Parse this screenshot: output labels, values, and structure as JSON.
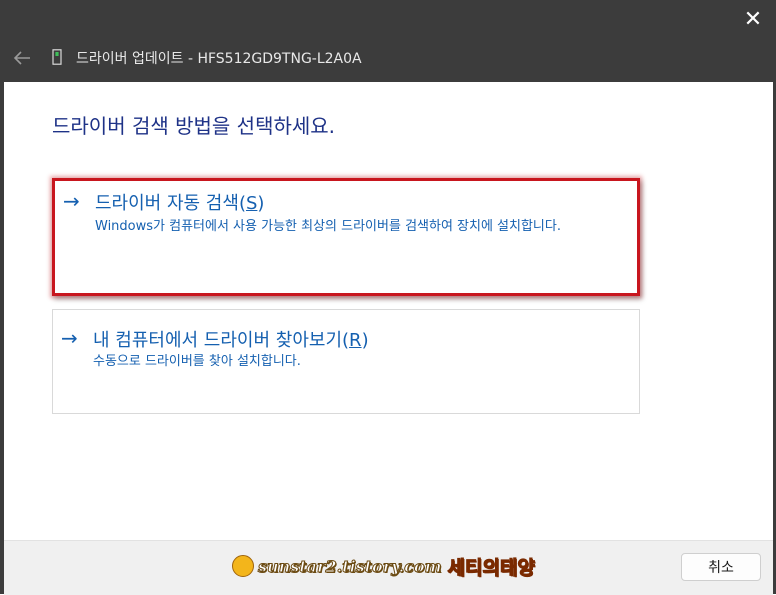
{
  "window": {
    "title": "드라이버 업데이트 - HFS512GD9TNG-L2A0A",
    "close_icon": "close-icon",
    "back_icon": "back-arrow-icon",
    "device_icon": "device-icon"
  },
  "heading": "드라이버 검색 방법을 선택하세요.",
  "options": [
    {
      "icon": "arrow-right-icon",
      "arrow": "→",
      "title": "드라이버 자동 검색",
      "accel": "S",
      "description": "Windows가 컴퓨터에서 사용 가능한 최상의 드라이버를 검색하여 장치에 설치합니다.",
      "highlighted": true
    },
    {
      "icon": "arrow-right-icon",
      "arrow": "→",
      "title": "내 컴퓨터에서 드라이버 찾아보기",
      "accel": "R",
      "description": "수동으로 드라이버를 찾아 설치합니다.",
      "highlighted": false
    }
  ],
  "footer": {
    "cancel_label": "취소",
    "watermark_url": "sunstar2.tistory.com",
    "watermark_name": "세티의태양"
  },
  "colors": {
    "titlebar": "#3c3c3c",
    "heading": "#1e3287",
    "link": "#1560b0",
    "highlight_border": "#c8161e",
    "footer": "#f0f0f0"
  }
}
